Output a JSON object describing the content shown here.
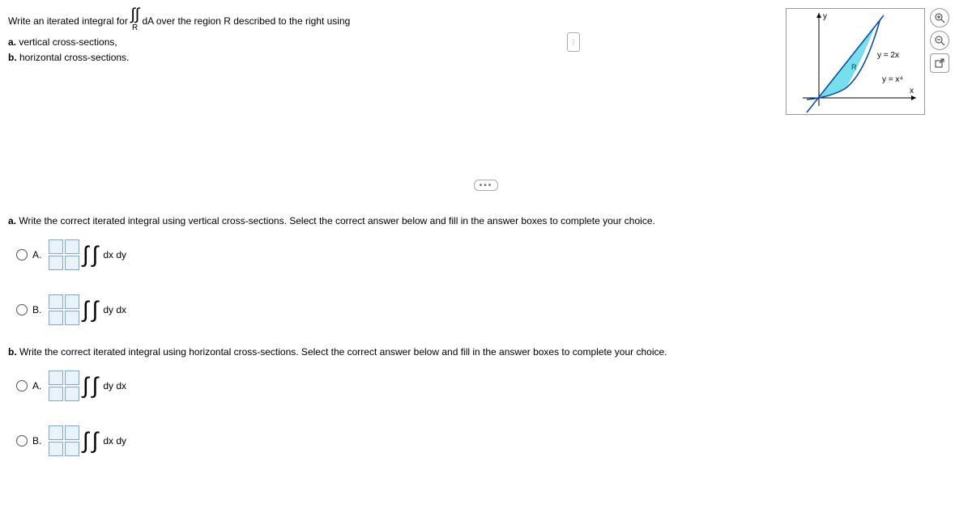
{
  "question": {
    "intro_pre": "Write an iterated integral for ",
    "intro_post": "dA over the region R described to the right using",
    "sub": "R",
    "part_a": "a.",
    "part_a_text": " vertical cross-sections,",
    "part_b": "b.",
    "part_b_text": " horizontal cross-sections."
  },
  "graph": {
    "y_axis": "y",
    "x_axis": "x",
    "curve1": "y = 2x",
    "curve2": "y = x⁴",
    "region": "R"
  },
  "sections": {
    "a_prompt_bold": "a.",
    "a_prompt": " Write the correct iterated integral using vertical cross-sections. Select the correct answer below and fill in the answer boxes to complete your choice.",
    "b_prompt_bold": "b.",
    "b_prompt": " Write the correct iterated integral using horizontal cross-sections. Select the correct answer below and fill in the answer boxes to complete your choice."
  },
  "choices": {
    "a": {
      "A": {
        "label": "A.",
        "diff": "dx dy"
      },
      "B": {
        "label": "B.",
        "diff": "dy dx"
      }
    },
    "b": {
      "A": {
        "label": "A.",
        "diff": "dy dx"
      },
      "B": {
        "label": "B.",
        "diff": "dx dy"
      }
    }
  },
  "icons": {
    "zoom_in": "⊕",
    "zoom_out": "⊖",
    "popout": "⇱",
    "dots": "⋮",
    "ellipsis": "•••"
  }
}
